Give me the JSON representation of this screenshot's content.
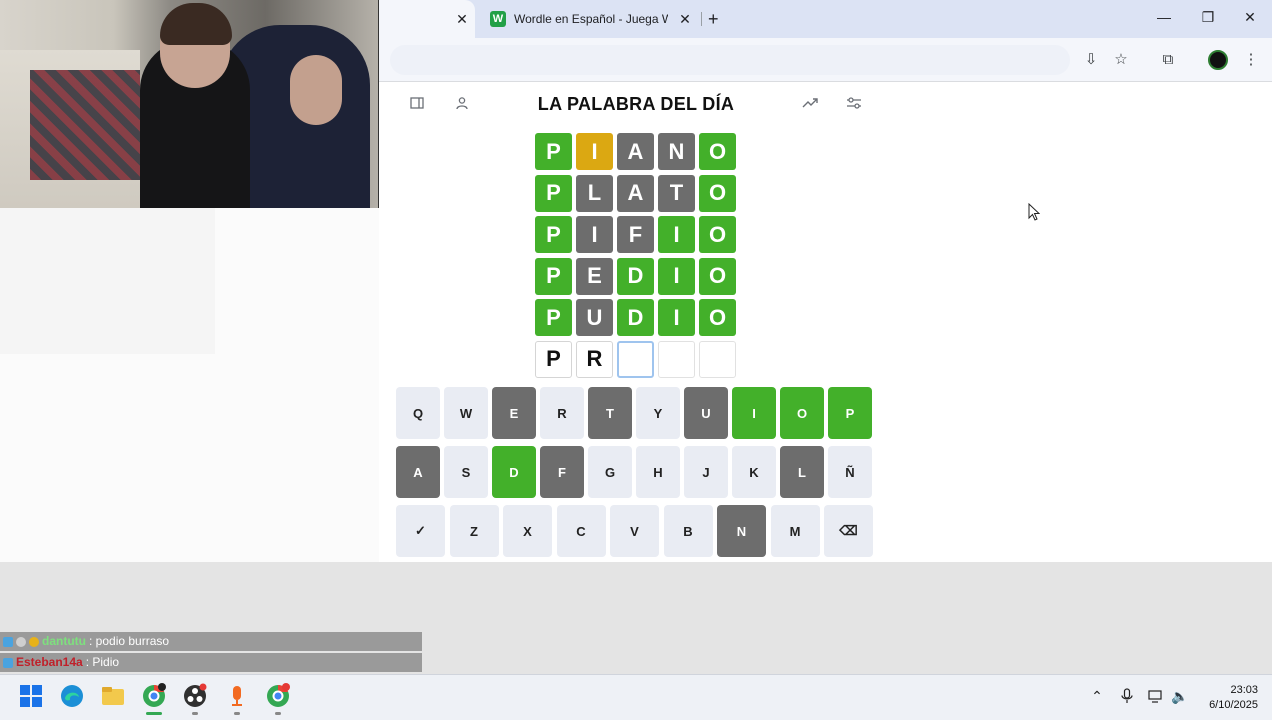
{
  "browser": {
    "tab_title": "Wordle en Español - Juega Wordle en Español",
    "tab_favicon_letter": "W"
  },
  "header": {
    "title": "LA PALABRA DEL DÍA"
  },
  "board": [
    [
      {
        "l": "P",
        "s": "correct"
      },
      {
        "l": "I",
        "s": "present"
      },
      {
        "l": "A",
        "s": "absent"
      },
      {
        "l": "N",
        "s": "absent"
      },
      {
        "l": "O",
        "s": "correct"
      }
    ],
    [
      {
        "l": "P",
        "s": "correct"
      },
      {
        "l": "L",
        "s": "absent"
      },
      {
        "l": "A",
        "s": "absent"
      },
      {
        "l": "T",
        "s": "absent"
      },
      {
        "l": "O",
        "s": "correct"
      }
    ],
    [
      {
        "l": "P",
        "s": "correct"
      },
      {
        "l": "I",
        "s": "absent"
      },
      {
        "l": "F",
        "s": "absent"
      },
      {
        "l": "I",
        "s": "correct"
      },
      {
        "l": "O",
        "s": "correct"
      }
    ],
    [
      {
        "l": "P",
        "s": "correct"
      },
      {
        "l": "E",
        "s": "absent"
      },
      {
        "l": "D",
        "s": "correct"
      },
      {
        "l": "I",
        "s": "correct"
      },
      {
        "l": "O",
        "s": "correct"
      }
    ],
    [
      {
        "l": "P",
        "s": "correct"
      },
      {
        "l": "U",
        "s": "absent"
      },
      {
        "l": "D",
        "s": "correct"
      },
      {
        "l": "I",
        "s": "correct"
      },
      {
        "l": "O",
        "s": "correct"
      }
    ],
    [
      {
        "l": "P",
        "s": "typed"
      },
      {
        "l": "R",
        "s": "typed"
      },
      {
        "l": "",
        "s": "cursor"
      },
      {
        "l": "",
        "s": "empty"
      },
      {
        "l": "",
        "s": "empty"
      }
    ]
  ],
  "keyboard": {
    "row1": [
      {
        "k": "Q"
      },
      {
        "k": "W"
      },
      {
        "k": "E",
        "s": "absent"
      },
      {
        "k": "R"
      },
      {
        "k": "T",
        "s": "absent"
      },
      {
        "k": "Y"
      },
      {
        "k": "U",
        "s": "absent"
      },
      {
        "k": "I",
        "s": "correct"
      },
      {
        "k": "O",
        "s": "correct"
      },
      {
        "k": "P",
        "s": "correct"
      }
    ],
    "row2": [
      {
        "k": "A",
        "s": "absent"
      },
      {
        "k": "S"
      },
      {
        "k": "D",
        "s": "correct"
      },
      {
        "k": "F",
        "s": "absent"
      },
      {
        "k": "G"
      },
      {
        "k": "H"
      },
      {
        "k": "J"
      },
      {
        "k": "K"
      },
      {
        "k": "L",
        "s": "absent"
      },
      {
        "k": "Ñ"
      }
    ],
    "row3": [
      {
        "k": "✓",
        "name": "enter"
      },
      {
        "k": "Z"
      },
      {
        "k": "X"
      },
      {
        "k": "C"
      },
      {
        "k": "V"
      },
      {
        "k": "B"
      },
      {
        "k": "N",
        "s": "absent"
      },
      {
        "k": "M"
      },
      {
        "k": "⌫",
        "name": "backspace"
      }
    ]
  },
  "chat": [
    {
      "user": "dantutu",
      "message": ": podio burraso",
      "user_color": "#7ee07e"
    },
    {
      "user": "Esteban14a",
      "message": ": Pidio",
      "user_color": "#c0202a"
    }
  ],
  "taskbar": {
    "time": "23:03",
    "date": "6/10/2025"
  },
  "colors": {
    "correct": "#43b02a",
    "present": "#dba812",
    "absent": "#6d6d6d"
  }
}
